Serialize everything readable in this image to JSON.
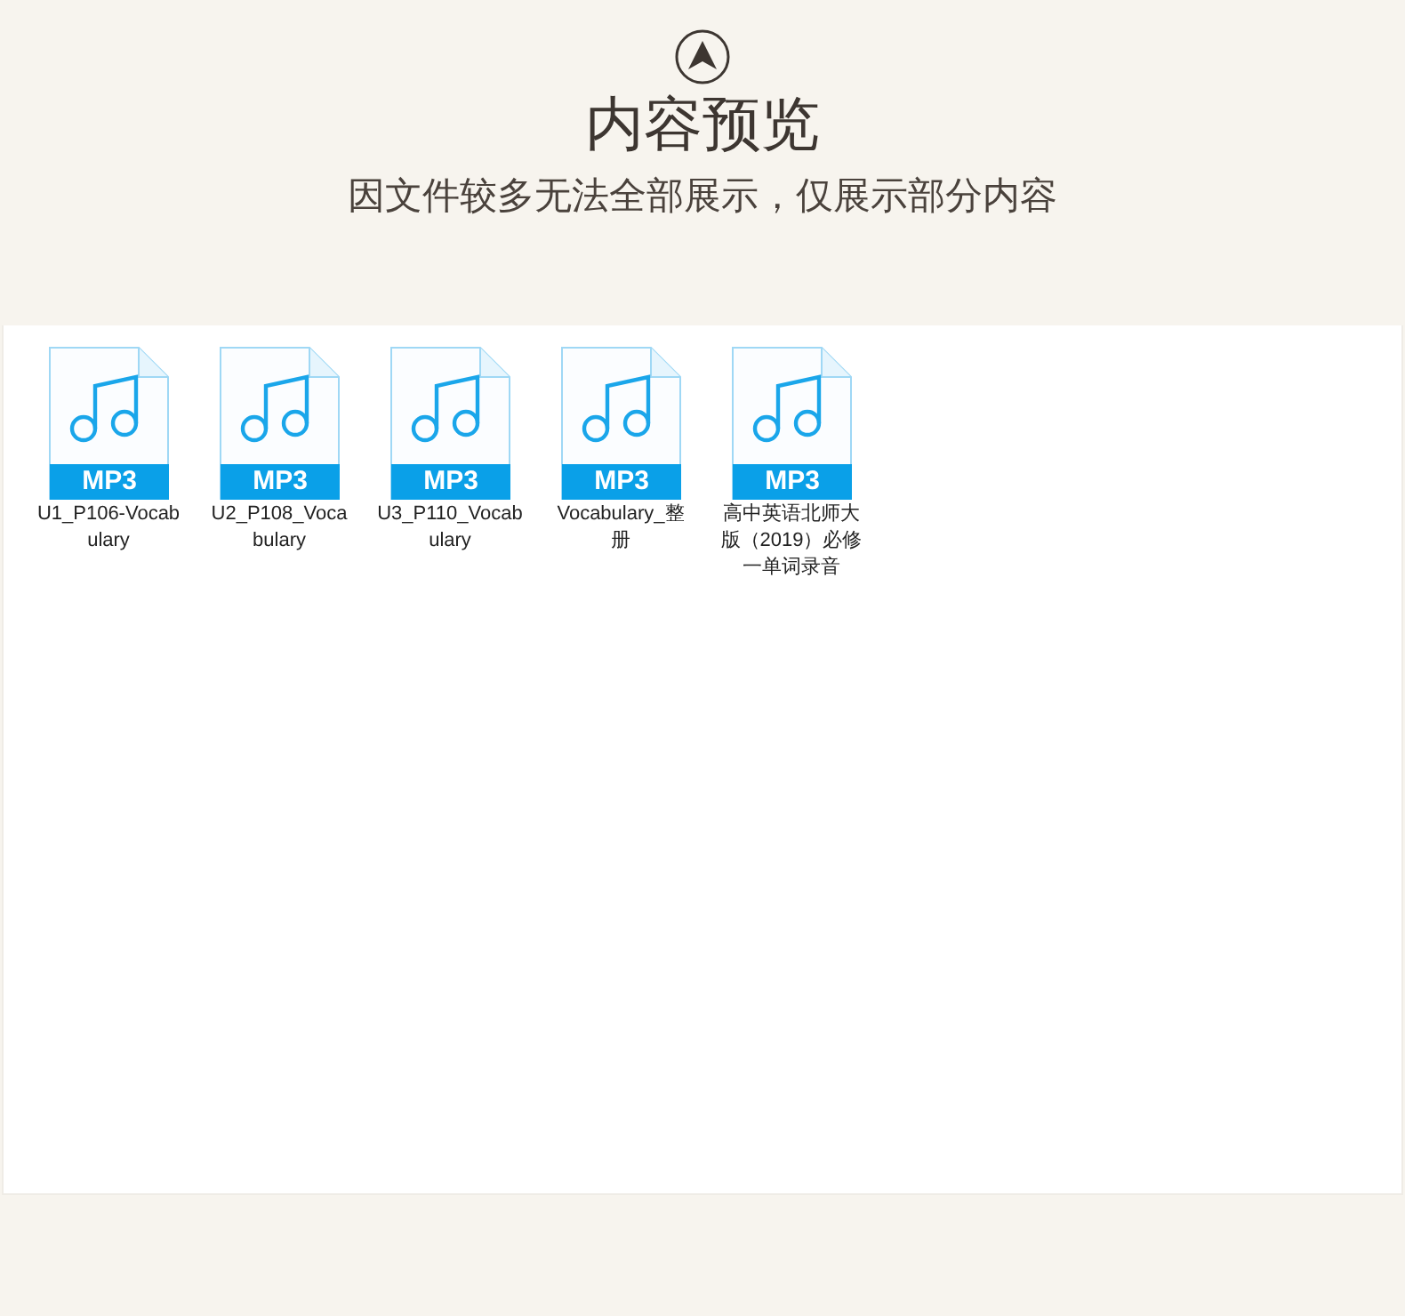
{
  "header": {
    "title": "内容预览",
    "subtitle": "因文件较多无法全部展示，仅展示部分内容"
  },
  "files": [
    {
      "badge": "MP3",
      "name": "U1_P106-Vocabulary"
    },
    {
      "badge": "MP3",
      "name": "U2_P108_Vocabulary"
    },
    {
      "badge": "MP3",
      "name": "U3_P110_Vocabulary"
    },
    {
      "badge": "MP3",
      "name": "Vocabulary_整册"
    },
    {
      "badge": "MP3",
      "name": "高中英语北师大版（2019）必修一单词录音"
    }
  ]
}
